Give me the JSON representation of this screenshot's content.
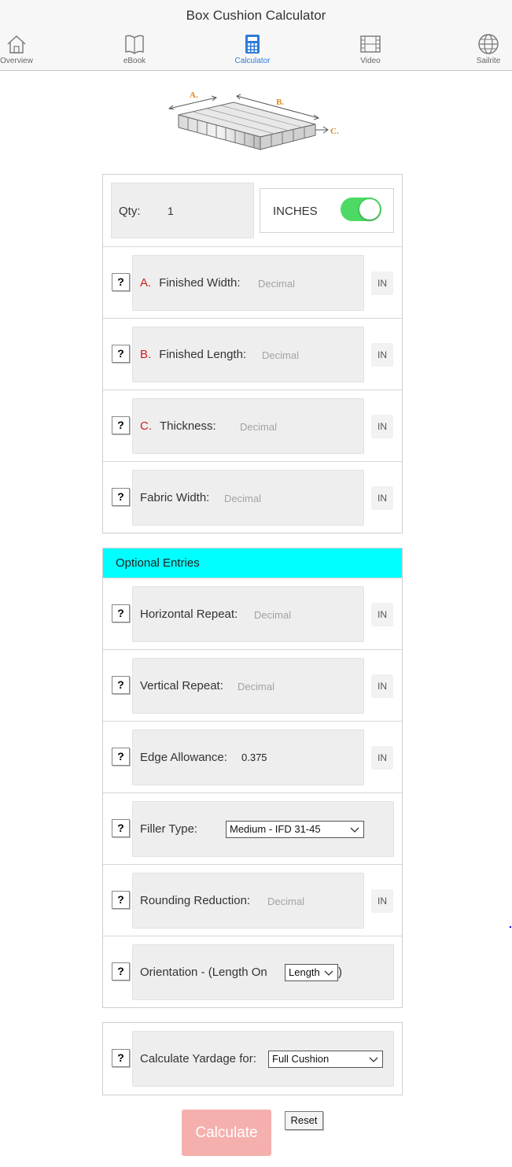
{
  "header": {
    "title": "Box Cushion Calculator",
    "tabs": [
      {
        "label": "Overview",
        "icon": "home-icon",
        "active": false
      },
      {
        "label": "eBook",
        "icon": "book-icon",
        "active": false
      },
      {
        "label": "Calculator",
        "icon": "calculator-icon",
        "active": true
      },
      {
        "label": "Video",
        "icon": "film-icon",
        "active": false
      },
      {
        "label": "Sailrite",
        "icon": "globe-icon",
        "active": false
      }
    ],
    "accent": "#2f7bd8"
  },
  "diagram": {
    "label_a": "A.",
    "label_b": "B.",
    "label_c": "C."
  },
  "qty": {
    "label": "Qty:",
    "value": "1"
  },
  "units": {
    "label": "INCHES",
    "toggle_on": true,
    "toggle_color": "#4cd964"
  },
  "help_label": "?",
  "unit_label": "IN",
  "required": [
    {
      "letter": "A.",
      "label": "Finished Width:",
      "placeholder": "Decimal"
    },
    {
      "letter": "B.",
      "label": "Finished Length:",
      "placeholder": "Decimal"
    },
    {
      "letter": "C.",
      "label": "Thickness:",
      "placeholder": "Decimal"
    },
    {
      "letter": "",
      "label": "Fabric Width:",
      "placeholder": "Decimal"
    }
  ],
  "optional": {
    "title": "Optional Entries",
    "header_color": "#00ffff",
    "horizontal_repeat": {
      "label": "Horizontal Repeat:",
      "placeholder": "Decimal"
    },
    "vertical_repeat": {
      "label": "Vertical Repeat:",
      "placeholder": "Decimal"
    },
    "edge_allowance": {
      "label": "Edge Allowance:",
      "value": "0.375"
    },
    "filler_type": {
      "label": "Filler Type:",
      "selected": "Medium - IFD 31-45"
    },
    "rounding_reduction": {
      "label": "Rounding Reduction:",
      "placeholder": "Decimal"
    },
    "orientation": {
      "label": "Orientation - (Length On",
      "selected": "Length",
      "suffix": ")"
    }
  },
  "yardage": {
    "label": "Calculate Yardage for:",
    "selected": "Full Cushion"
  },
  "actions": {
    "calculate": "Calculate",
    "reset": "Reset",
    "calculate_color": "#f5b0ae"
  }
}
